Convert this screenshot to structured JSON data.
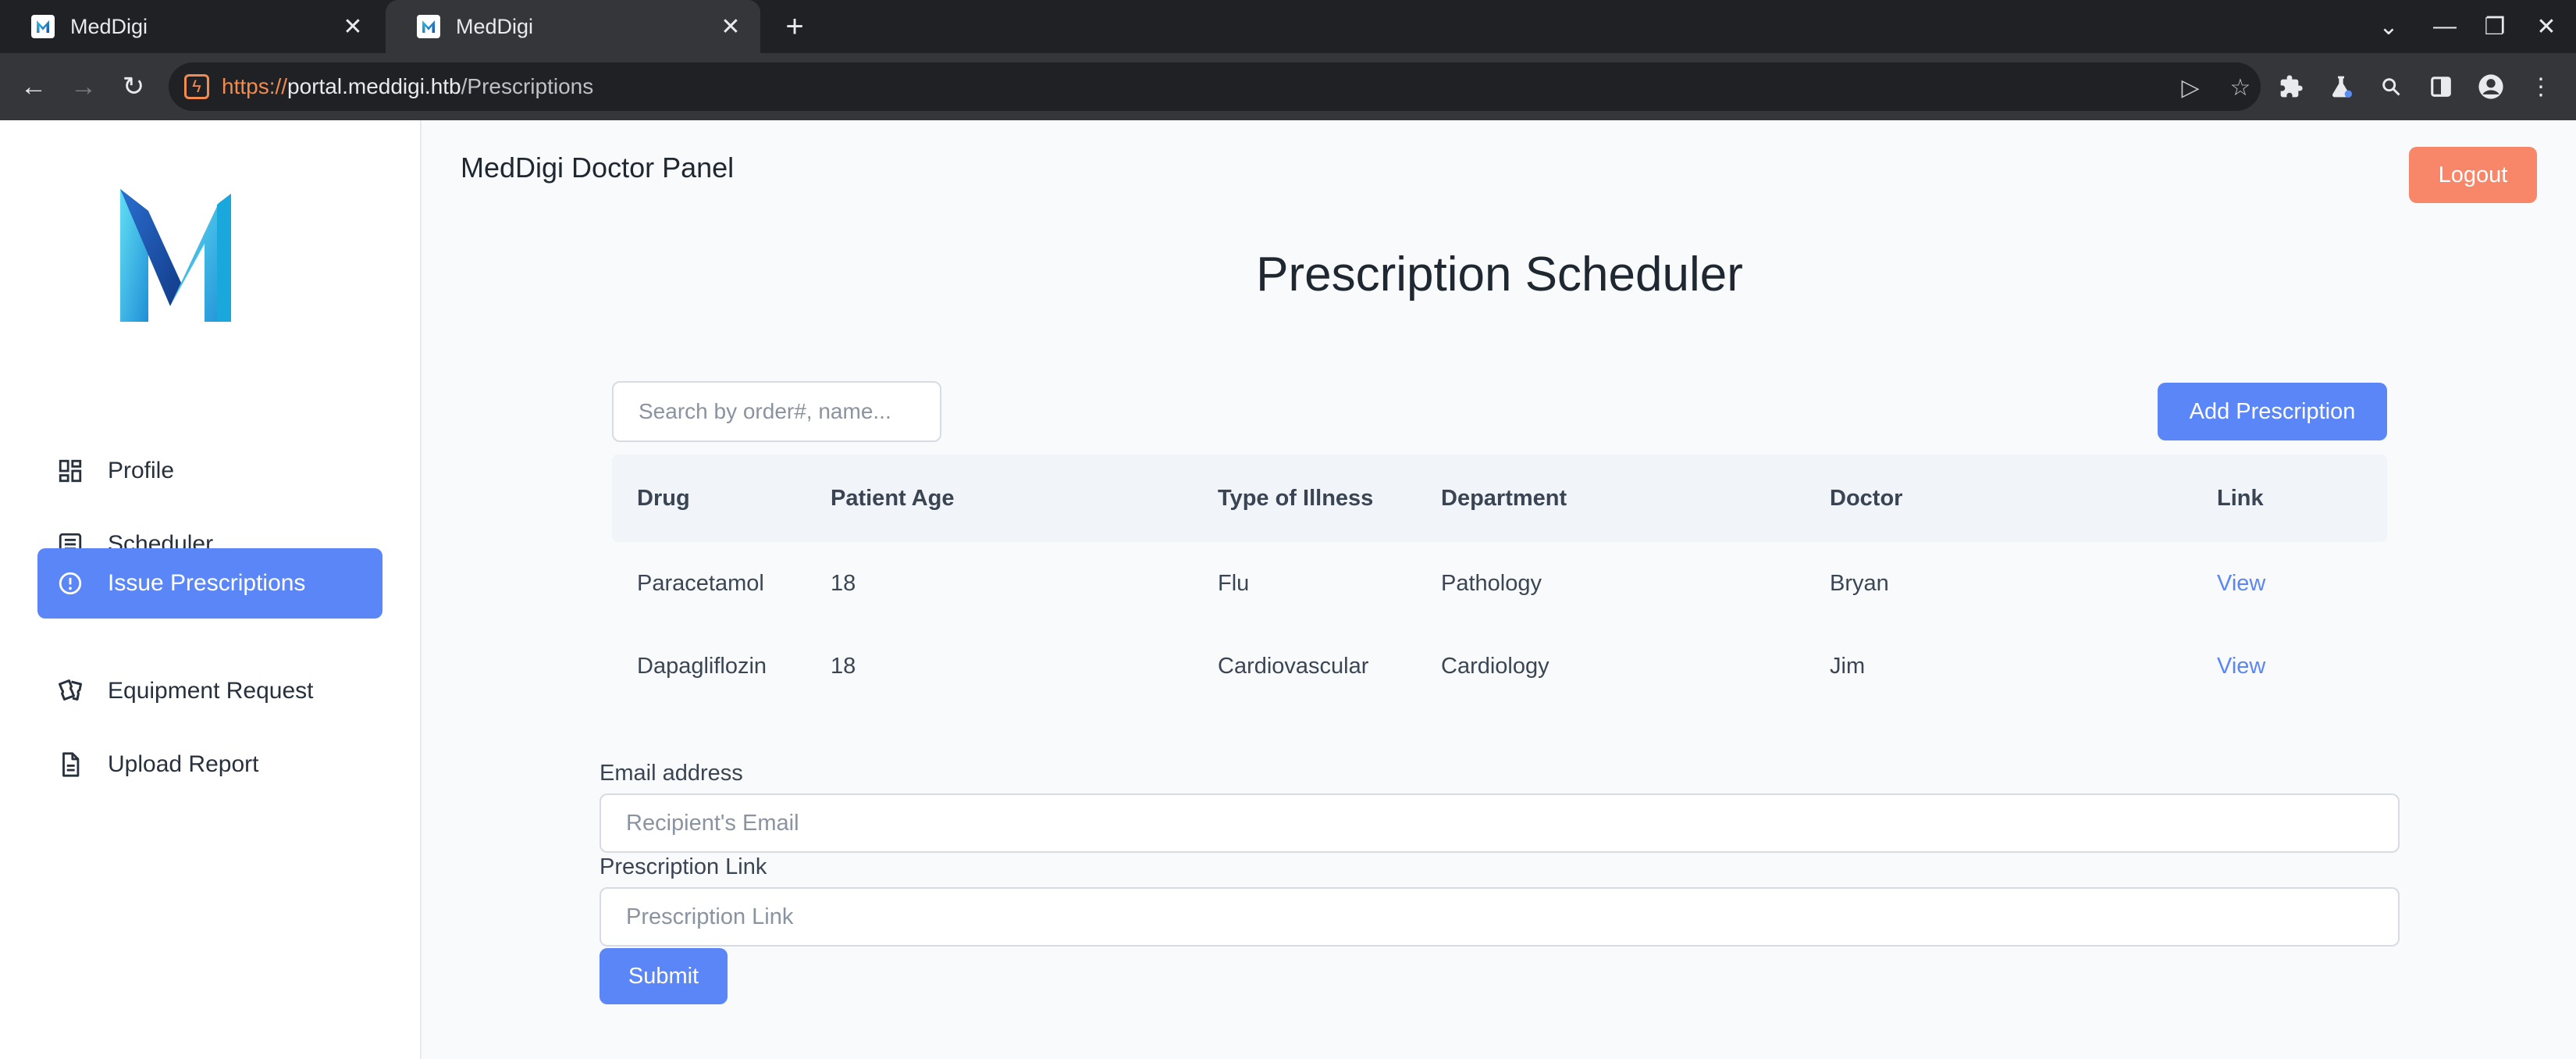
{
  "browser": {
    "tabs": [
      {
        "title": "MedDigi"
      },
      {
        "title": "MedDigi"
      }
    ],
    "url": {
      "scheme": "https://",
      "host": "portal.meddigi.htb",
      "path": "/Prescriptions"
    }
  },
  "sidebar": {
    "items": [
      {
        "label": "Profile",
        "icon": "dashboard-icon"
      },
      {
        "label": "Scheduler",
        "icon": "list-icon"
      },
      {
        "label": "Issue Prescriptions",
        "icon": "alert-circle-icon",
        "active": true
      },
      {
        "label": "Equipment Request",
        "icon": "tickets-icon"
      },
      {
        "label": "Upload Report",
        "icon": "document-icon"
      }
    ]
  },
  "header": {
    "panel_title": "MedDigi Doctor Panel",
    "logout_label": "Logout"
  },
  "main": {
    "title": "Prescription Scheduler",
    "search_placeholder": "Search by order#, name...",
    "add_label": "Add Prescription",
    "table": {
      "columns": [
        "Drug",
        "Patient Age",
        "Type of Illness",
        "Department",
        "Doctor",
        "Link"
      ],
      "rows": [
        [
          "Paracetamol",
          "18",
          "Flu",
          "Pathology",
          "Bryan",
          "View"
        ],
        [
          "Dapagliflozin",
          "18",
          "Cardiovascular",
          "Cardiology",
          "Jim",
          "View"
        ]
      ]
    },
    "form": {
      "email_label": "Email address",
      "email_placeholder": "Recipient's Email",
      "link_label": "Prescription Link",
      "link_placeholder": "Prescription Link",
      "submit_label": "Submit"
    }
  },
  "colors": {
    "accent": "#5b86f7",
    "logout": "#f8876a",
    "link": "#5b86f7"
  }
}
